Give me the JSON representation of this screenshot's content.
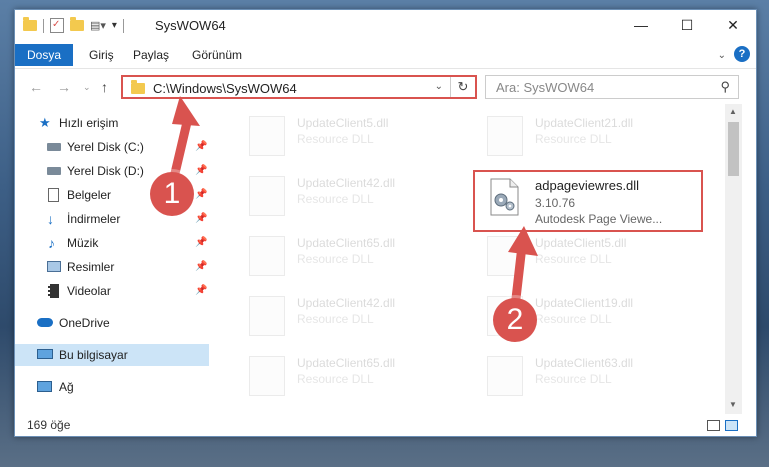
{
  "window": {
    "title": "SysWOW64",
    "controls": {
      "minimize": "—",
      "maximize": "☐",
      "close": "✕"
    }
  },
  "ribbon": {
    "tabs": [
      "Dosya",
      "Giriş",
      "Paylaş",
      "Görünüm"
    ]
  },
  "address": {
    "path": "C:\\Windows\\SysWOW64",
    "search_placeholder": "Ara: SysWOW64"
  },
  "sidebar": {
    "quick_access": "Hızlı erişim",
    "items": [
      "Yerel Disk (C:)",
      "Yerel Disk (D:)",
      "Belgeler",
      "İndirmeler",
      "Müzik",
      "Resimler",
      "Videolar"
    ],
    "onedrive": "OneDrive",
    "this_pc": "Bu bilgisayar",
    "network": "Ağ"
  },
  "files": {
    "left": [
      {
        "name": "UpdateClient5.dll",
        "type": "Resource DLL"
      },
      {
        "name": "UpdateClient42.dll",
        "type": "Resource DLL"
      },
      {
        "name": "UpdateClient65.dll",
        "type": "Resource DLL"
      },
      {
        "name": "UpdateClient42.dll",
        "type": "Resource DLL"
      },
      {
        "name": "UpdateClient65.dll",
        "type": "Resource DLL"
      }
    ],
    "right": [
      {
        "name": "UpdateClient21.dll",
        "type": "Resource DLL"
      },
      {
        "name": "UpdateClient5.dll",
        "type": "Resource DLL"
      },
      {
        "name": "UpdateClient19.dll",
        "type": "Resource DLL"
      },
      {
        "name": "UpdateClient63.dll",
        "type": "Resource DLL"
      }
    ],
    "highlighted": {
      "name": "adpageviewres.dll",
      "version": "3.10.76",
      "description": "Autodesk Page Viewe..."
    }
  },
  "status": {
    "count": "169 öğe"
  },
  "annotations": {
    "step1": "1",
    "step2": "2"
  },
  "colors": {
    "accent": "#1a6fc4",
    "highlight": "#d9534f",
    "selection": "#cce4f7"
  }
}
